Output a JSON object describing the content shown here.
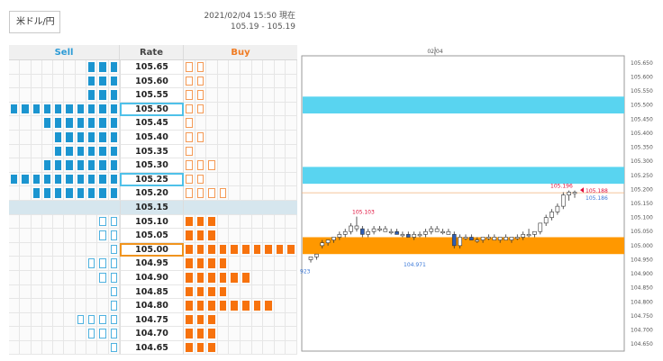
{
  "header": {
    "pair": "米ドル/円",
    "time_line": "2021/02/04 15:50 現在",
    "bid_ask": "105.19 - 105.19"
  },
  "table": {
    "sell_label": "Sell",
    "rate_label": "Rate",
    "buy_label": "Buy",
    "rows": [
      {
        "rate": "105.65",
        "sell_fill": 3,
        "sell_out": 0,
        "buy_fill": 0,
        "buy_out": 2
      },
      {
        "rate": "105.60",
        "sell_fill": 3,
        "sell_out": 0,
        "buy_fill": 0,
        "buy_out": 2
      },
      {
        "rate": "105.55",
        "sell_fill": 3,
        "sell_out": 0,
        "buy_fill": 0,
        "buy_out": 2
      },
      {
        "rate": "105.50",
        "sell_fill": 10,
        "sell_out": 0,
        "buy_fill": 0,
        "buy_out": 2,
        "hl": "sell"
      },
      {
        "rate": "105.45",
        "sell_fill": 7,
        "sell_out": 0,
        "buy_fill": 0,
        "buy_out": 1
      },
      {
        "rate": "105.40",
        "sell_fill": 6,
        "sell_out": 0,
        "buy_fill": 0,
        "buy_out": 2
      },
      {
        "rate": "105.35",
        "sell_fill": 6,
        "sell_out": 0,
        "buy_fill": 0,
        "buy_out": 1
      },
      {
        "rate": "105.30",
        "sell_fill": 7,
        "sell_out": 0,
        "buy_fill": 0,
        "buy_out": 3
      },
      {
        "rate": "105.25",
        "sell_fill": 10,
        "sell_out": 0,
        "buy_fill": 0,
        "buy_out": 2,
        "hl": "sell"
      },
      {
        "rate": "105.20",
        "sell_fill": 8,
        "sell_out": 0,
        "buy_fill": 0,
        "buy_out": 4
      },
      {
        "rate": "105.15",
        "sell_fill": 0,
        "sell_out": 0,
        "buy_fill": 0,
        "buy_out": 0,
        "mid": true
      },
      {
        "rate": "105.10",
        "sell_fill": 0,
        "sell_out": 2,
        "buy_fill": 3,
        "buy_out": 0
      },
      {
        "rate": "105.05",
        "sell_fill": 0,
        "sell_out": 2,
        "buy_fill": 3,
        "buy_out": 0
      },
      {
        "rate": "105.00",
        "sell_fill": 0,
        "sell_out": 1,
        "buy_fill": 10,
        "buy_out": 0,
        "hl": "buy"
      },
      {
        "rate": "104.95",
        "sell_fill": 0,
        "sell_out": 3,
        "buy_fill": 4,
        "buy_out": 0
      },
      {
        "rate": "104.90",
        "sell_fill": 0,
        "sell_out": 2,
        "buy_fill": 6,
        "buy_out": 0
      },
      {
        "rate": "104.85",
        "sell_fill": 0,
        "sell_out": 1,
        "buy_fill": 4,
        "buy_out": 0
      },
      {
        "rate": "104.80",
        "sell_fill": 0,
        "sell_out": 1,
        "buy_fill": 8,
        "buy_out": 0
      },
      {
        "rate": "104.75",
        "sell_fill": 0,
        "sell_out": 4,
        "buy_fill": 3,
        "buy_out": 0
      },
      {
        "rate": "104.70",
        "sell_fill": 0,
        "sell_out": 3,
        "buy_fill": 3,
        "buy_out": 0
      },
      {
        "rate": "104.65",
        "sell_fill": 0,
        "sell_out": 1,
        "buy_fill": 3,
        "buy_out": 0
      }
    ]
  },
  "chart": {
    "date_label": "02/04",
    "y_ticks": [
      "105.650",
      "105.600",
      "105.550",
      "105.500",
      "105.450",
      "105.400",
      "105.350",
      "105.300",
      "105.250",
      "105.200",
      "105.150",
      "105.100",
      "105.050",
      "105.000",
      "104.950",
      "104.900",
      "104.850",
      "104.800",
      "104.750",
      "104.700",
      "104.650"
    ],
    "price_label_1": "105.188",
    "price_label_2": "105.186",
    "high_label": "105.103",
    "low_label": "104.971",
    "recent_high_label": "105.196",
    "left_cut_label": "923",
    "colors": {
      "cyan_band": "#59d4f0",
      "orange_band": "#ff9800",
      "up": "#ffffff",
      "down": "#2f5fb5",
      "accent_red": "#e0103c",
      "accent_blue": "#3a78d8"
    }
  },
  "chart_data": {
    "type": "candlestick",
    "y_range": [
      104.625,
      105.675
    ],
    "bands": [
      {
        "from": 105.47,
        "to": 105.53,
        "color": "cyan"
      },
      {
        "from": 105.22,
        "to": 105.28,
        "color": "cyan"
      },
      {
        "from": 104.97,
        "to": 105.03,
        "color": "orange"
      }
    ],
    "reference_lines": [
      105.188,
      105.186
    ],
    "candles": [
      [
        104.95,
        104.96,
        104.94,
        104.96
      ],
      [
        104.96,
        104.97,
        104.95,
        104.97
      ],
      [
        105.0,
        105.02,
        104.99,
        105.01
      ],
      [
        105.01,
        105.02,
        105.0,
        105.02
      ],
      [
        105.02,
        105.03,
        105.01,
        105.03
      ],
      [
        105.03,
        105.05,
        105.02,
        105.04
      ],
      [
        105.04,
        105.06,
        105.03,
        105.05
      ],
      [
        105.05,
        105.08,
        105.04,
        105.07
      ],
      [
        105.07,
        105.103,
        105.05,
        105.06
      ],
      [
        105.06,
        105.07,
        105.03,
        105.04
      ],
      [
        105.04,
        105.06,
        105.03,
        105.05
      ],
      [
        105.05,
        105.07,
        105.04,
        105.06
      ],
      [
        105.06,
        105.07,
        105.05,
        105.06
      ],
      [
        105.06,
        105.07,
        105.05,
        105.05
      ],
      [
        105.05,
        105.06,
        105.04,
        105.05
      ],
      [
        105.05,
        105.06,
        105.04,
        105.04
      ],
      [
        105.04,
        105.05,
        105.03,
        105.04
      ],
      [
        105.04,
        105.05,
        105.03,
        105.03
      ],
      [
        105.03,
        105.05,
        105.02,
        105.04
      ],
      [
        105.04,
        105.05,
        105.03,
        105.04
      ],
      [
        105.04,
        105.06,
        105.03,
        105.05
      ],
      [
        105.05,
        105.07,
        105.04,
        105.06
      ],
      [
        105.06,
        105.07,
        105.05,
        105.05
      ],
      [
        105.05,
        105.06,
        105.04,
        105.05
      ],
      [
        105.05,
        105.06,
        105.04,
        105.04
      ],
      [
        105.04,
        105.05,
        104.99,
        105.0
      ],
      [
        105.0,
        105.04,
        104.99,
        105.03
      ],
      [
        105.03,
        105.04,
        105.02,
        105.03
      ],
      [
        105.03,
        105.04,
        105.02,
        105.02
      ],
      [
        105.02,
        105.03,
        105.01,
        105.02
      ],
      [
        105.02,
        105.03,
        105.01,
        105.03
      ],
      [
        105.03,
        105.04,
        105.02,
        105.03
      ],
      [
        105.03,
        105.04,
        105.02,
        105.02
      ],
      [
        105.02,
        105.03,
        105.01,
        105.03
      ],
      [
        105.03,
        105.04,
        105.02,
        105.02
      ],
      [
        105.02,
        105.03,
        105.01,
        105.03
      ],
      [
        105.03,
        105.04,
        105.02,
        105.03
      ],
      [
        105.03,
        105.05,
        105.02,
        105.04
      ],
      [
        105.04,
        105.06,
        105.03,
        105.04
      ],
      [
        105.04,
        105.05,
        105.03,
        105.05
      ],
      [
        105.05,
        105.08,
        105.04,
        105.08
      ],
      [
        105.08,
        105.11,
        105.07,
        105.1
      ],
      [
        105.1,
        105.13,
        105.09,
        105.12
      ],
      [
        105.12,
        105.15,
        105.11,
        105.14
      ],
      [
        105.14,
        105.19,
        105.13,
        105.18
      ],
      [
        105.18,
        105.196,
        105.16,
        105.19
      ],
      [
        105.19,
        105.196,
        105.17,
        105.19
      ]
    ],
    "down_indices": [
      9,
      15,
      17,
      25,
      28
    ]
  }
}
